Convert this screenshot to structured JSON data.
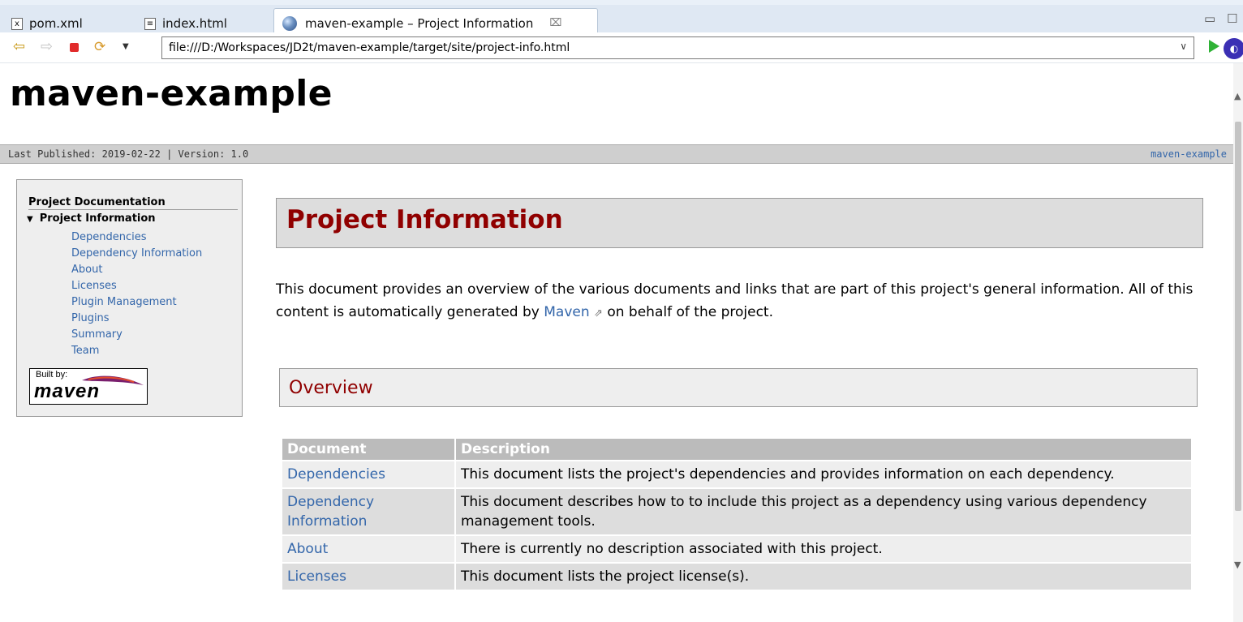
{
  "tabs": [
    {
      "label": "pom.xml",
      "icon": "xml-file-icon"
    },
    {
      "label": "index.html",
      "icon": "html-file-icon"
    },
    {
      "label": "maven-example – Project Information",
      "icon": "globe-icon",
      "close": "⌧"
    }
  ],
  "toolbar": {
    "url": "file:///D:/Workspaces/JD2t/maven-example/target/site/project-info.html"
  },
  "site": {
    "title": "maven-example",
    "banner_left": "Last Published: 2019-02-22  | Version: 1.0",
    "banner_right": "maven-example"
  },
  "nav": {
    "heading": "Project Documentation",
    "current": "Project Information",
    "items": [
      "Dependencies",
      "Dependency Information",
      "About",
      "Licenses",
      "Plugin Management",
      "Plugins",
      "Summary",
      "Team"
    ],
    "badge_built": "Built by:",
    "badge_maven": "maven"
  },
  "main": {
    "heading": "Project Information",
    "intro_before": "This document provides an overview of the various documents and links that are part of this project's general information. All of this content is automatically generated by ",
    "intro_link": "Maven",
    "intro_after": " on behalf of the project.",
    "overview_heading": "Overview",
    "table": {
      "headers": [
        "Document",
        "Description"
      ],
      "rows": [
        {
          "doc": "Dependencies",
          "desc": "This document lists the project's dependencies and provides information on each dependency."
        },
        {
          "doc": "Dependency Information",
          "desc": "This document describes how to to include this project as a dependency using various dependency management tools."
        },
        {
          "doc": "About",
          "desc": "There is currently no description associated with this project."
        },
        {
          "doc": "Licenses",
          "desc": "This document lists the project license(s)."
        }
      ]
    }
  }
}
